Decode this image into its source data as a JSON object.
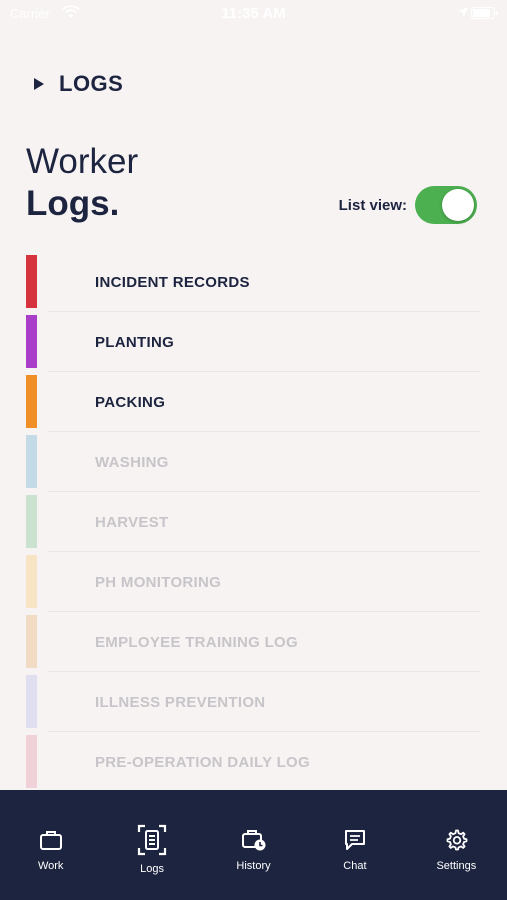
{
  "status": {
    "carrier": "Carrier",
    "time": "11:35 AM",
    "battery_fraction": 0.92
  },
  "header": {
    "breadcrumb": "LOGS",
    "title_line1": "Worker",
    "title_line2": "Logs."
  },
  "list_view": {
    "label": "List view:",
    "enabled": true
  },
  "logs": [
    {
      "name": "INCIDENT RECORDS",
      "color": "#d7333f",
      "active": true
    },
    {
      "name": "PLANTING",
      "color": "#a93ec8",
      "active": true
    },
    {
      "name": "PACKING",
      "color": "#ef8f26",
      "active": true
    },
    {
      "name": "WASHING",
      "color": "#2f8fc9",
      "active": false
    },
    {
      "name": "HARVEST",
      "color": "#4caf6a",
      "active": false
    },
    {
      "name": "PH MONITORING",
      "color": "#f2b63c",
      "active": false
    },
    {
      "name": "EMPLOYEE TRAINING LOG",
      "color": "#e3953b",
      "active": false
    },
    {
      "name": "ILLNESS PREVENTION",
      "color": "#9aa4e6",
      "active": false
    },
    {
      "name": "PRE-OPERATION DAILY LOG",
      "color": "#d76b87",
      "active": false
    }
  ],
  "tabs": [
    {
      "label": "Work",
      "icon": "briefcase-icon"
    },
    {
      "label": "Logs",
      "icon": "logs-icon",
      "selected": true
    },
    {
      "label": "History",
      "icon": "history-icon"
    },
    {
      "label": "Chat",
      "icon": "chat-icon"
    },
    {
      "label": "Settings",
      "icon": "gear-icon"
    }
  ],
  "colors": {
    "navy": "#1d2440",
    "background": "#f7f3f2",
    "toggle_on": "#4caf50"
  }
}
